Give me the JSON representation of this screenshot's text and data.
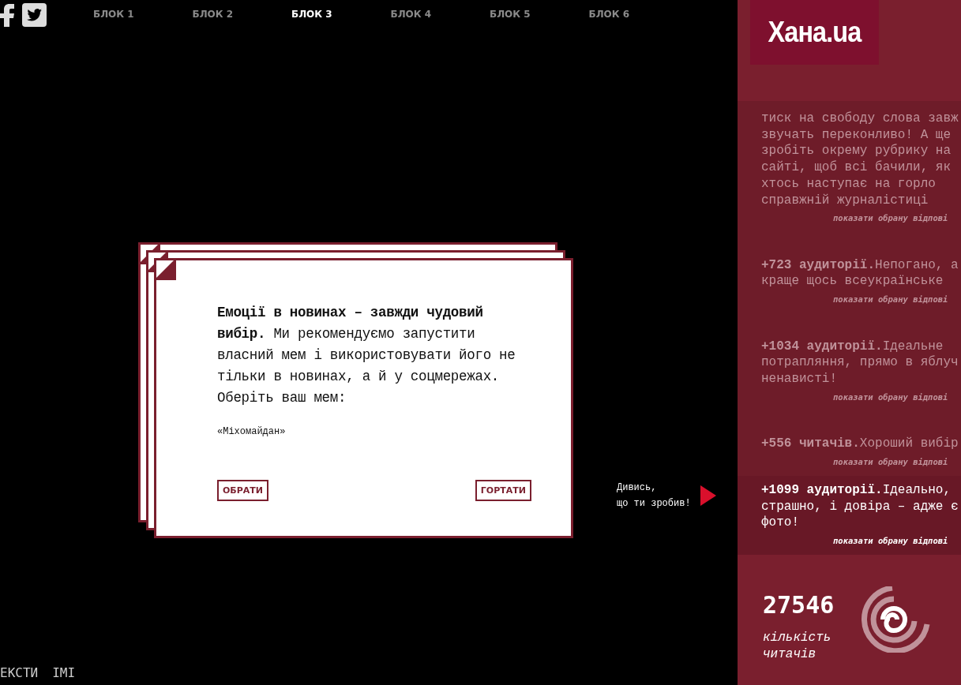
{
  "nav": {
    "items": [
      {
        "label": "БЛОК 1",
        "selected": false
      },
      {
        "label": "БЛОК 2",
        "selected": false
      },
      {
        "label": "БЛОК 3",
        "selected": true
      },
      {
        "label": "БЛОК 4",
        "selected": false
      },
      {
        "label": "БЛОК 5",
        "selected": false
      },
      {
        "label": "БЛОК 6",
        "selected": false
      }
    ]
  },
  "card": {
    "text": "**Емоції в новинах – завжди чудовий вибір.** Ми рекомендуємо запустити власний мем і використовувати його не тільки в новинах, а й у соцмережах. Оберіть ваш мем:",
    "option": "«Міхомайдан»",
    "buttons": [
      "ОБРАТИ",
      "ГОРТАТИ"
    ]
  },
  "hint": {
    "lines": [
      "Дивись,",
      "що ти зробив!"
    ]
  },
  "bottom_links": [
    "ЕКСТИ",
    "ІМІ"
  ],
  "sidebar": {
    "logo": "Хана.ua",
    "answers": [
      {
        "lines": [
          "тиск на свободу слова завж",
          "звучать переконливо! А ще",
          "зробіть окрему рубрику на",
          "сайті, щоб всі бачили, як",
          "хтось наступає на горло",
          "справжній журналістиці"
        ],
        "link": "показати обрану відпові",
        "selected": false
      },
      {
        "lines": [
          "**+723 аудиторії.**Непогано, а",
          "краще щось всеукраїнське"
        ],
        "link": "показати обрану відпові",
        "selected": false
      },
      {
        "lines": [
          "**+1034 аудиторії.**Ідеальне",
          "потрапляння, прямо в яблуч",
          "ненависті!"
        ],
        "link": "показати обрану відпові",
        "selected": false
      },
      {
        "lines": [
          "**+556 читачів.**Хороший вибір"
        ],
        "link": "показати обрану відпові",
        "selected": false
      },
      {
        "lines": [
          "**+1099 аудиторії.**Ідеально,",
          "страшно, і довіра – адже є",
          "фото!"
        ],
        "link": "показати обрану відпові",
        "selected": true
      }
    ],
    "count": "27546",
    "count_label": "кількість читачів"
  }
}
